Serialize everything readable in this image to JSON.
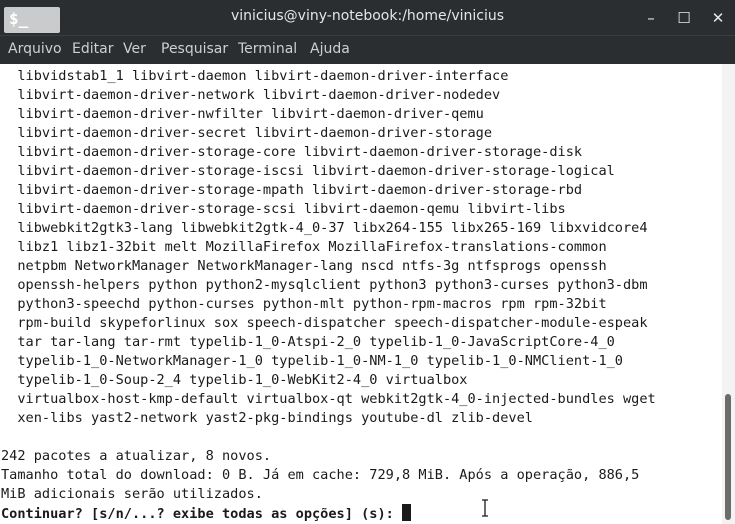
{
  "window": {
    "icon_text": "$_",
    "title": "vinicius@viny-notebook:/home/vinicius",
    "minimize": "–",
    "maximize": "☐",
    "close": "✕"
  },
  "menu": [
    "Arquivo",
    "Editar",
    "Ver",
    "Pesquisar",
    "Terminal",
    "Ajuda"
  ],
  "terminal": {
    "lines": [
      "  libvidstab1_1 libvirt-daemon libvirt-daemon-driver-interface",
      "  libvirt-daemon-driver-network libvirt-daemon-driver-nodedev",
      "  libvirt-daemon-driver-nwfilter libvirt-daemon-driver-qemu",
      "  libvirt-daemon-driver-secret libvirt-daemon-driver-storage",
      "  libvirt-daemon-driver-storage-core libvirt-daemon-driver-storage-disk",
      "  libvirt-daemon-driver-storage-iscsi libvirt-daemon-driver-storage-logical",
      "  libvirt-daemon-driver-storage-mpath libvirt-daemon-driver-storage-rbd",
      "  libvirt-daemon-driver-storage-scsi libvirt-daemon-qemu libvirt-libs",
      "  libwebkit2gtk3-lang libwebkit2gtk-4_0-37 libx264-155 libx265-169 libxvidcore4",
      "  libz1 libz1-32bit melt MozillaFirefox MozillaFirefox-translations-common",
      "  netpbm NetworkManager NetworkManager-lang nscd ntfs-3g ntfsprogs openssh",
      "  openssh-helpers python python2-mysqlclient python3 python3-curses python3-dbm",
      "  python3-speechd python-curses python-mlt python-rpm-macros rpm rpm-32bit",
      "  rpm-build skypeforlinux sox speech-dispatcher speech-dispatcher-module-espeak",
      "  tar tar-lang tar-rmt typelib-1_0-Atspi-2_0 typelib-1_0-JavaScriptCore-4_0",
      "  typelib-1_0-NetworkManager-1_0 typelib-1_0-NM-1_0 typelib-1_0-NMClient-1_0",
      "  typelib-1_0-Soup-2_4 typelib-1_0-WebKit2-4_0 virtualbox",
      "  virtualbox-host-kmp-default virtualbox-qt webkit2gtk-4_0-injected-bundles wget",
      "  xen-libs yast2-network yast2-pkg-bindings youtube-dl zlib-devel",
      "",
      "242 pacotes a atualizar, 8 novos.",
      "Tamanho total do download: 0 B. Já em cache: 729,8 MiB. Após a operação, 886,5",
      "MiB adicionais serão utilizados."
    ],
    "prompt": "Continuar? [s/n/...? exibe todas as opções] (s): "
  }
}
